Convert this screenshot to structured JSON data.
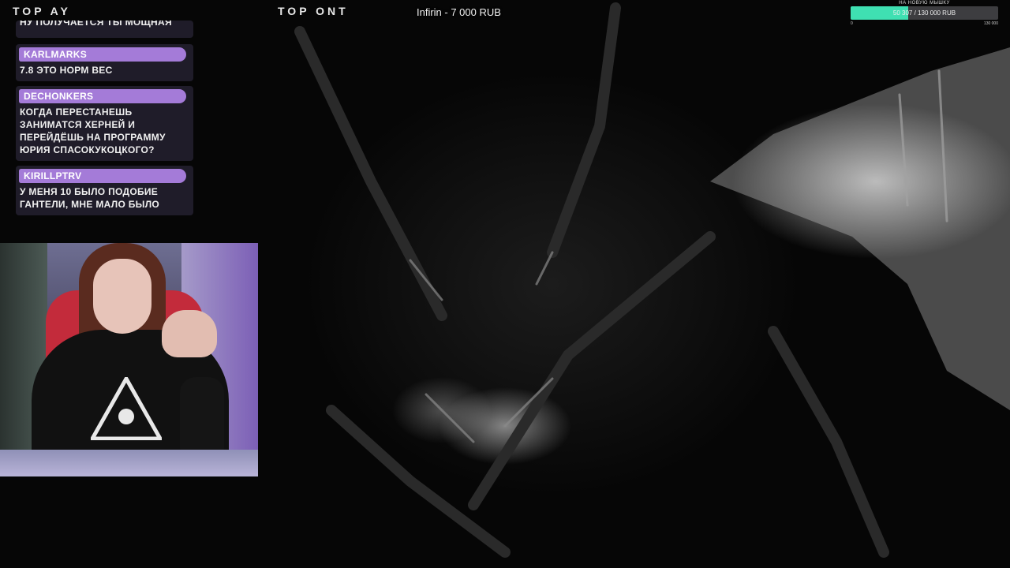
{
  "overlay": {
    "top_left_label": "TOP  AY",
    "top_center_label": "TOP  ONT",
    "donation_ticker": "Infirin - 7 000 RUB"
  },
  "goal": {
    "title": "НА НОВУЮ МЫШКУ",
    "text": "50 307 / 130 000 RUB",
    "min_label": "0",
    "max_label": "130 000",
    "progress_fraction": 0.39,
    "fill_color": "#3fe0b2"
  },
  "chat": {
    "partial_text": "НУ ПОЛУЧАЕТСЯ ТЫ МОЩНАЯ",
    "messages": [
      {
        "user": "KARLMARKS",
        "text": "7.8 ЭТО НОРМ ВЕС"
      },
      {
        "user": "DECHONKERS",
        "text": "КОГДА ПЕРЕСТАНЕШЬ ЗАНИМАТСЯ ХЕРНЕЙ И ПЕРЕЙДЁШЬ НА ПРОГРАММУ ЮРИЯ СПАСОКУКОЦКОГО?"
      },
      {
        "user": "KIRILLPTRV",
        "text": "У МЕНЯ 10 БЫЛО ПОДОБИЕ ГАНТЕЛИ, МНЕ МАЛО БЫЛО"
      }
    ],
    "username_color": "#a47bd8"
  }
}
